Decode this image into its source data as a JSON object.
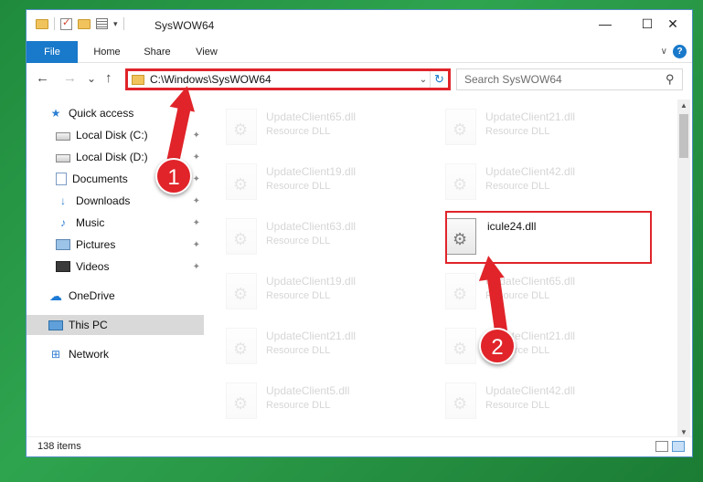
{
  "window": {
    "title": "SysWOW64",
    "minimize": "—",
    "maximize": "☐",
    "close": "✕"
  },
  "ribbon": {
    "tabs": [
      "File",
      "Home",
      "Share",
      "View"
    ],
    "help": "?"
  },
  "nav": {
    "back": "←",
    "forward": "→",
    "recent": "⌄",
    "up": "↑",
    "address_path": "C:\\Windows\\SysWOW64",
    "refresh": "↻",
    "search_placeholder": "Search SysWOW64"
  },
  "sidebar": {
    "items": [
      {
        "label": "Quick access",
        "icon": "star-icon",
        "glyph": "★",
        "pinned": false
      },
      {
        "label": "Local Disk (C:)",
        "icon": "drive-icon",
        "glyph": "",
        "pinned": true
      },
      {
        "label": "Local Disk (D:)",
        "icon": "drive-icon",
        "glyph": "",
        "pinned": true
      },
      {
        "label": "Documents",
        "icon": "documents-icon",
        "glyph": "",
        "pinned": true
      },
      {
        "label": "Downloads",
        "icon": "download-icon",
        "glyph": "↓",
        "pinned": true
      },
      {
        "label": "Music",
        "icon": "music-icon",
        "glyph": "♪",
        "pinned": true
      },
      {
        "label": "Pictures",
        "icon": "pictures-icon",
        "glyph": "",
        "pinned": true
      },
      {
        "label": "Videos",
        "icon": "videos-icon",
        "glyph": "",
        "pinned": true
      },
      {
        "label": "OneDrive",
        "icon": "onedrive-icon",
        "glyph": "☁",
        "pinned": false
      },
      {
        "label": "This PC",
        "icon": "pc-icon",
        "glyph": "",
        "pinned": false
      },
      {
        "label": "Network",
        "icon": "network-icon",
        "glyph": "⊞",
        "pinned": false
      }
    ],
    "pin_glyph": "📌"
  },
  "files": {
    "left": [
      {
        "name": "UpdateClient65.dll",
        "type": "Resource DLL"
      },
      {
        "name": "UpdateClient19.dll",
        "type": "Resource DLL"
      },
      {
        "name": "UpdateClient63.dll",
        "type": "Resource DLL"
      },
      {
        "name": "UpdateClient19.dll",
        "type": "Resource DLL"
      },
      {
        "name": "UpdateClient21.dll",
        "type": "Resource DLL"
      },
      {
        "name": "UpdateClient5.dll",
        "type": "Resource DLL"
      }
    ],
    "right": [
      {
        "name": "UpdateClient21.dll",
        "type": "Resource DLL"
      },
      {
        "name": "UpdateClient42.dll",
        "type": "Resource DLL"
      },
      {
        "name": "icule24.dll",
        "type": ""
      },
      {
        "name": "UpdateClient65.dll",
        "type": "Resource DLL"
      },
      {
        "name": "UpdateClient21.dll",
        "type": "Resource DLL"
      },
      {
        "name": "UpdateClient42.dll",
        "type": "Resource DLL"
      }
    ]
  },
  "status": {
    "item_count": "138 items"
  },
  "annotations": {
    "badge_1": "1",
    "badge_2": "2",
    "color": "#e0242a"
  }
}
